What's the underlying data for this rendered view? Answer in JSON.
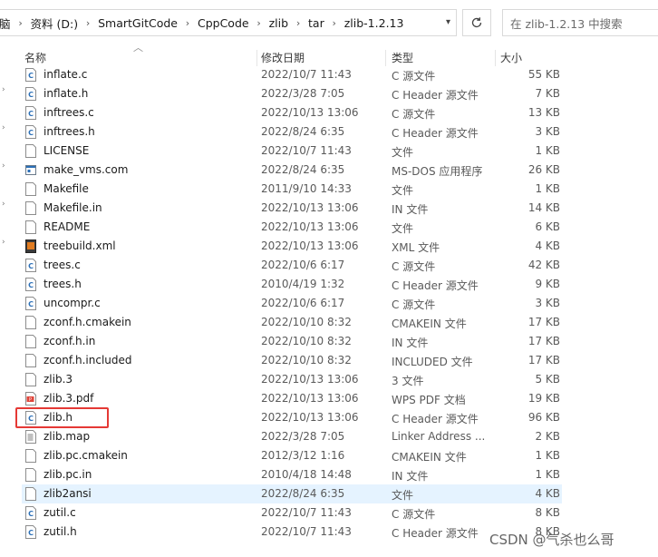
{
  "address_bar": {
    "cut_label": "脑",
    "breadcrumbs": [
      "资料 (D:)",
      "SmartGitCode",
      "CppCode",
      "zlib",
      "tar",
      "zlib-1.2.13"
    ]
  },
  "search": {
    "placeholder": "在 zlib-1.2.13 中搜索"
  },
  "columns": {
    "name": "名称",
    "date": "修改日期",
    "type": "类型",
    "size": "大小"
  },
  "files": [
    {
      "name": "inflate.c",
      "date": "2022/10/7 11:43",
      "type": "C 源文件",
      "size": "55 KB",
      "icon": "c-source-file-icon"
    },
    {
      "name": "inflate.h",
      "date": "2022/3/28 7:05",
      "type": "C Header 源文件",
      "size": "7 KB",
      "icon": "c-header-file-icon"
    },
    {
      "name": "inftrees.c",
      "date": "2022/10/13 13:06",
      "type": "C 源文件",
      "size": "13 KB",
      "icon": "c-source-file-icon"
    },
    {
      "name": "inftrees.h",
      "date": "2022/8/24 6:35",
      "type": "C Header 源文件",
      "size": "3 KB",
      "icon": "c-header-file-icon"
    },
    {
      "name": "LICENSE",
      "date": "2022/10/7 11:43",
      "type": "文件",
      "size": "1 KB",
      "icon": "generic-file-icon"
    },
    {
      "name": "make_vms.com",
      "date": "2022/8/24 6:35",
      "type": "MS-DOS 应用程序",
      "size": "26 KB",
      "icon": "ms-dos-application-icon"
    },
    {
      "name": "Makefile",
      "date": "2011/9/10 14:33",
      "type": "文件",
      "size": "1 KB",
      "icon": "generic-file-icon"
    },
    {
      "name": "Makefile.in",
      "date": "2022/10/13 13:06",
      "type": "IN 文件",
      "size": "14 KB",
      "icon": "generic-file-icon"
    },
    {
      "name": "README",
      "date": "2022/10/13 13:06",
      "type": "文件",
      "size": "6 KB",
      "icon": "generic-file-icon"
    },
    {
      "name": "treebuild.xml",
      "date": "2022/10/13 13:06",
      "type": "XML 文件",
      "size": "4 KB",
      "icon": "xml-file-icon"
    },
    {
      "name": "trees.c",
      "date": "2022/10/6 6:17",
      "type": "C 源文件",
      "size": "42 KB",
      "icon": "c-source-file-icon"
    },
    {
      "name": "trees.h",
      "date": "2010/4/19 1:32",
      "type": "C Header 源文件",
      "size": "9 KB",
      "icon": "c-header-file-icon"
    },
    {
      "name": "uncompr.c",
      "date": "2022/10/6 6:17",
      "type": "C 源文件",
      "size": "3 KB",
      "icon": "c-source-file-icon"
    },
    {
      "name": "zconf.h.cmakein",
      "date": "2022/10/10 8:32",
      "type": "CMAKEIN 文件",
      "size": "17 KB",
      "icon": "generic-file-icon"
    },
    {
      "name": "zconf.h.in",
      "date": "2022/10/10 8:32",
      "type": "IN 文件",
      "size": "17 KB",
      "icon": "generic-file-icon"
    },
    {
      "name": "zconf.h.included",
      "date": "2022/10/10 8:32",
      "type": "INCLUDED 文件",
      "size": "17 KB",
      "icon": "generic-file-icon"
    },
    {
      "name": "zlib.3",
      "date": "2022/10/13 13:06",
      "type": "3 文件",
      "size": "5 KB",
      "icon": "generic-file-icon"
    },
    {
      "name": "zlib.3.pdf",
      "date": "2022/10/13 13:06",
      "type": "WPS PDF 文档",
      "size": "19 KB",
      "icon": "pdf-file-icon"
    },
    {
      "name": "zlib.h",
      "date": "2022/10/13 13:06",
      "type": "C Header 源文件",
      "size": "96 KB",
      "icon": "c-header-file-icon"
    },
    {
      "name": "zlib.map",
      "date": "2022/3/28 7:05",
      "type": "Linker Address ...",
      "size": "2 KB",
      "icon": "map-file-icon"
    },
    {
      "name": "zlib.pc.cmakein",
      "date": "2012/3/12 1:16",
      "type": "CMAKEIN 文件",
      "size": "1 KB",
      "icon": "generic-file-icon"
    },
    {
      "name": "zlib.pc.in",
      "date": "2010/4/18 14:48",
      "type": "IN 文件",
      "size": "1 KB",
      "icon": "generic-file-icon"
    },
    {
      "name": "zlib2ansi",
      "date": "2022/8/24 6:35",
      "type": "文件",
      "size": "4 KB",
      "icon": "generic-file-icon",
      "selected": true
    },
    {
      "name": "zutil.c",
      "date": "2022/10/7 11:43",
      "type": "C 源文件",
      "size": "8 KB",
      "icon": "c-source-file-icon"
    },
    {
      "name": "zutil.h",
      "date": "2022/10/7 11:43",
      "type": "C Header 源文件",
      "size": "8 KB",
      "icon": "c-header-file-icon"
    }
  ],
  "watermark": "CSDN @气杀也么哥",
  "colors": {
    "selected_row": "#e5f3ff",
    "highlight_box": "#e53935",
    "c_icon": "#2b6fb7"
  }
}
